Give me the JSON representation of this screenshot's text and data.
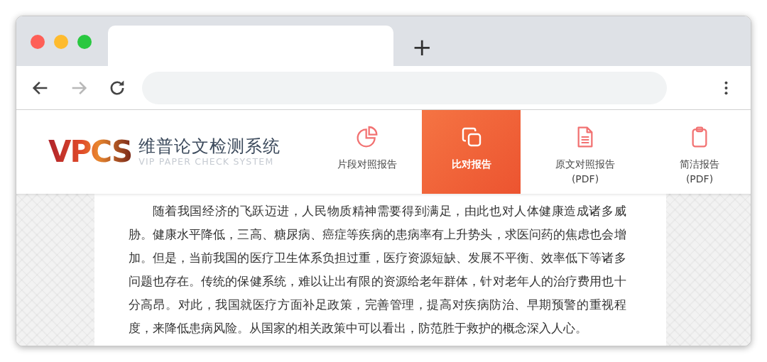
{
  "browser": {
    "new_tab": "+",
    "nav_buttons": [
      {
        "kind": "back",
        "disabled": false
      },
      {
        "kind": "forward",
        "disabled": true
      },
      {
        "kind": "reload",
        "disabled": false
      }
    ]
  },
  "site": {
    "logo": {
      "mark": "VPCS",
      "name": "维普论文检测系统",
      "tagline": "VIP PAPER CHECK SYSTEM"
    },
    "report_tabs": [
      {
        "kind": "pie",
        "label": "片段对照报告",
        "selected": false
      },
      {
        "kind": "copy",
        "label": "比对报告",
        "selected": true
      },
      {
        "kind": "document",
        "label": "原文对照报告",
        "sublabel": "(PDF)",
        "selected": false
      },
      {
        "kind": "clipboard",
        "label": "简洁报告",
        "sublabel": "(PDF)",
        "selected": false
      }
    ]
  },
  "document": {
    "paragraphs": [
      "随着我国经济的飞跃迈进，人民物质精神需要得到满足，由此也对人体健康造成诸多威胁。健康水平降低，三高、糖尿病、癌症等疾病的患病率有上升势头，求医问药的焦虑也会增加。但是，当前我国的医疗卫生体系负担过重，医疗资源短缺、发展不平衡、效率低下等诸多问题也存在。传统的保健系统，难以让出有限的资源给老年群体，针对老年人的治疗费用也十分高昂。对此，我国就医疗方面补足政策，完善管理，提高对疾病防治、早期预警的重视程度，来降低患病风险。从国家的相关政策中可以看出，防范胜于救护的概念深入人心。"
    ]
  }
}
